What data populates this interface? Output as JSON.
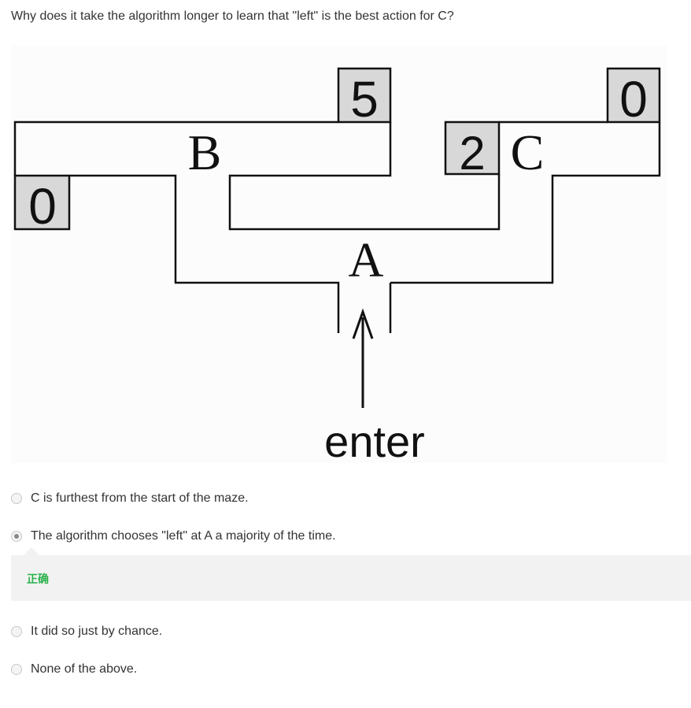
{
  "question": {
    "text": "Why does it take the algorithm longer to learn that \"left\" is the best action for C?"
  },
  "figure": {
    "reward_top_left": "5",
    "reward_top_right": "0",
    "reward_left": "0",
    "reward_c": "2",
    "label_b": "B",
    "label_c": "C",
    "label_a": "A",
    "entry_label": "enter"
  },
  "options": [
    {
      "label": "C is furthest from the start of the maze.",
      "selected": false
    },
    {
      "label": "The algorithm chooses \"left\" at A a majority of the time.",
      "selected": true
    },
    {
      "label": "It did so just by chance.",
      "selected": false
    },
    {
      "label": "None of the above.",
      "selected": false
    }
  ],
  "feedback": {
    "text": "正确",
    "color": "#2bb24c"
  }
}
